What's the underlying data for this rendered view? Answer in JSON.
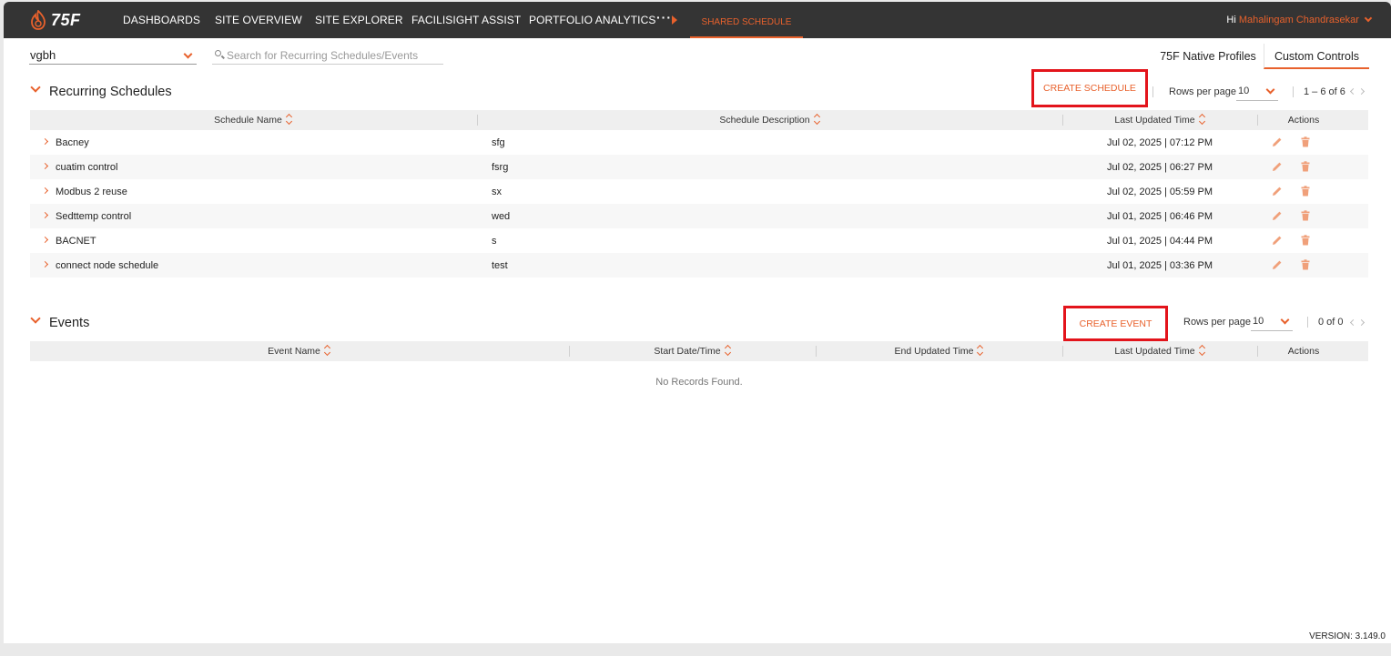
{
  "nav": {
    "logo_text": "75F",
    "items": [
      "DASHBOARDS",
      "SITE OVERVIEW",
      "SITE EXPLORER",
      "FACILISIGHT ASSIST",
      "PORTFOLIO ANALYTICS"
    ],
    "more": "···",
    "active": "SHARED SCHEDULE",
    "greeting": "Hi",
    "user": "Mahalingam Chandrasekar"
  },
  "filter": {
    "site": "vgbh",
    "search_placeholder": "Search for Recurring Schedules/Events"
  },
  "tabs": [
    "75F Native Profiles",
    "Custom Controls"
  ],
  "schedules": {
    "title": "Recurring Schedules",
    "create_label": "CREATE SCHEDULE",
    "rows_per_page_label": "Rows per page",
    "rows_per_page": "10",
    "range": "1 – 6 of 6",
    "columns": [
      "Schedule Name",
      "Schedule Description",
      "Last Updated Time",
      "Actions"
    ],
    "rows": [
      {
        "name": "Bacney",
        "description": "sfg",
        "updated": "Jul 02, 2025 | 07:12 PM"
      },
      {
        "name": "cuatim control",
        "description": "fsrg",
        "updated": "Jul 02, 2025 | 06:27 PM"
      },
      {
        "name": "Modbus 2 reuse",
        "description": "sx",
        "updated": "Jul 02, 2025 | 05:59 PM"
      },
      {
        "name": "Sedttemp control",
        "description": "wed",
        "updated": "Jul 01, 2025 | 06:46 PM"
      },
      {
        "name": "BACNET",
        "description": "s",
        "updated": "Jul 01, 2025 | 04:44 PM"
      },
      {
        "name": "connect node schedule",
        "description": "test",
        "updated": "Jul 01, 2025 | 03:36 PM"
      }
    ]
  },
  "events": {
    "title": "Events",
    "create_label": "CREATE EVENT",
    "rows_per_page_label": "Rows per page",
    "rows_per_page": "10",
    "range": "0 of 0",
    "columns": [
      "Event Name",
      "Start Date/Time",
      "End Updated Time",
      "Last Updated Time",
      "Actions"
    ],
    "empty_text": "No Records Found."
  },
  "version": "VERSION: 3.149.0",
  "colors": {
    "accent": "#e8612c",
    "nav_bg": "#343434",
    "highlight": "#e3141b"
  }
}
